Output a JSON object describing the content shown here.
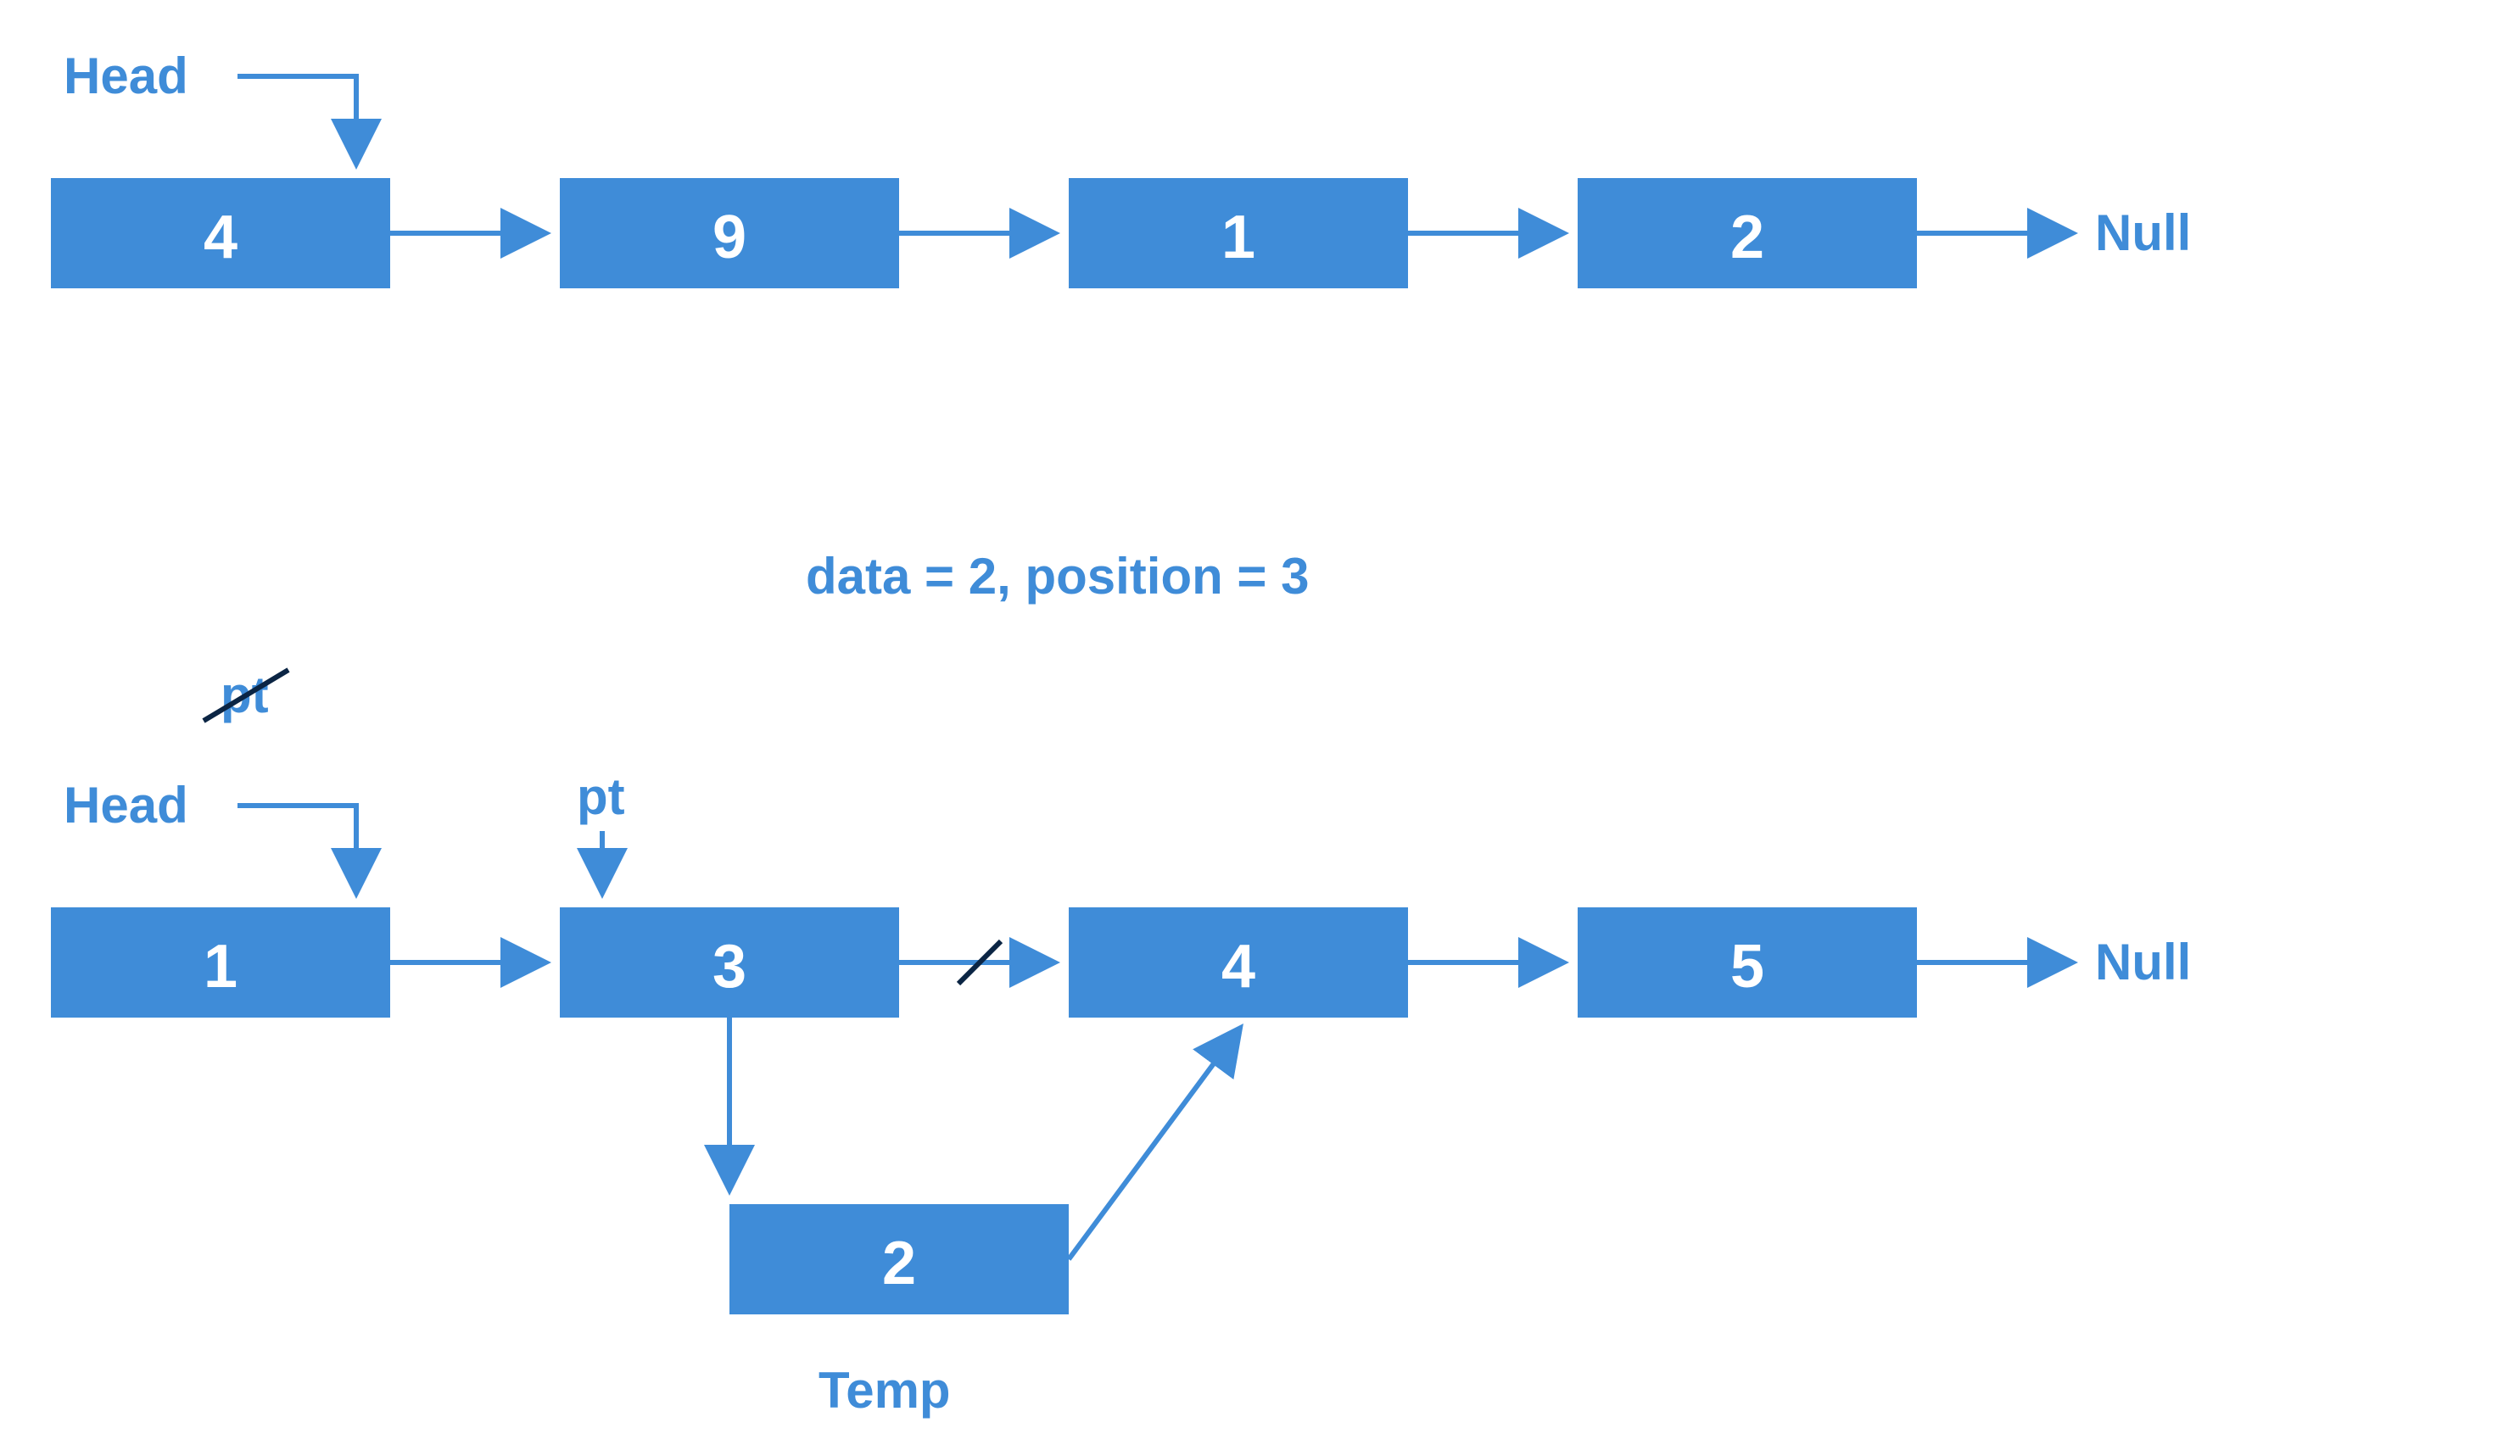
{
  "colors": {
    "node_fill": "#3f8cd8",
    "text_blue": "#3f8cd8",
    "strike_dark": "#0b2544"
  },
  "labels": {
    "head": "Head",
    "null": "Null",
    "pt_crossed": "pt",
    "pt": "pt",
    "temp": "Temp",
    "info": "data = 2, position = 3"
  },
  "list_top": {
    "nodes": [
      {
        "value": "4"
      },
      {
        "value": "9"
      },
      {
        "value": "1"
      },
      {
        "value": "2"
      }
    ],
    "end": "Null",
    "head_points_to_index": 0
  },
  "list_bottom": {
    "nodes": [
      {
        "value": "1"
      },
      {
        "value": "3"
      },
      {
        "value": "4"
      },
      {
        "value": "5"
      }
    ],
    "end": "Null",
    "head_points_to_index": 0,
    "pt_crossed_index": 0,
    "pt_index": 1,
    "broken_link_between": [
      1,
      2
    ],
    "inserted_node": {
      "value": "2",
      "label": "Temp",
      "link_from_index": 1,
      "link_to_index": 2
    }
  }
}
